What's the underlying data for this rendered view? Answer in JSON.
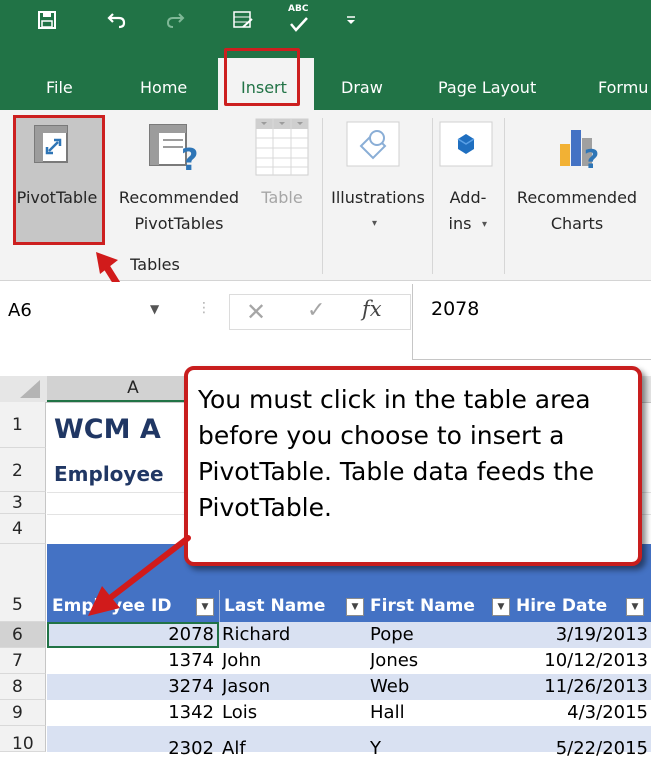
{
  "colors": {
    "excel_green": "#217346",
    "highlight_red": "#cc1f1f",
    "table_header_blue": "#4472c4",
    "band_blue": "#d9e1f2"
  },
  "quick_access": {
    "icons": [
      "save-icon",
      "undo-icon",
      "redo-icon",
      "form-icon",
      "spelling-icon",
      "customize-icon"
    ],
    "spelling_text": "ABC"
  },
  "tabs": [
    "File",
    "Home",
    "Insert",
    "Draw",
    "Page Layout",
    "Formu"
  ],
  "ribbon": {
    "pivottable": "PivotTable",
    "recommended_pivot_line1": "Recommended",
    "recommended_pivot_line2": "PivotTables",
    "table": "Table",
    "illustrations": "Illustrations",
    "addins_line1": "Add-",
    "addins_line2": "ins",
    "recommended_charts_line1": "Recommended",
    "recommended_charts_line2": "Charts",
    "group_tables": "Tables"
  },
  "formula_bar": {
    "name_box": "A6",
    "fx": "fx",
    "value": "2078"
  },
  "grid": {
    "column_a": "A",
    "row_numbers": [
      "1",
      "2",
      "3",
      "4",
      "5",
      "6",
      "7",
      "8",
      "9",
      "10"
    ],
    "title": "WCM A",
    "subtitle": "Employee",
    "headers": [
      "Employee ID",
      "Last Name",
      "First Name",
      "Hire Date"
    ],
    "rows": [
      [
        "2078",
        "Richard",
        "Pope",
        "3/19/2013"
      ],
      [
        "1374",
        "John",
        "Jones",
        "10/12/2013"
      ],
      [
        "3274",
        "Jason",
        "Web",
        "11/26/2013"
      ],
      [
        "1342",
        "Lois",
        "Hall",
        "4/3/2015"
      ]
    ],
    "partial_row": [
      "2302",
      "Alf",
      "Y",
      "5/22/2015"
    ]
  },
  "callout": "You must click in the table area before you choose to insert a PivotTable. Table data feeds the PivotTable."
}
